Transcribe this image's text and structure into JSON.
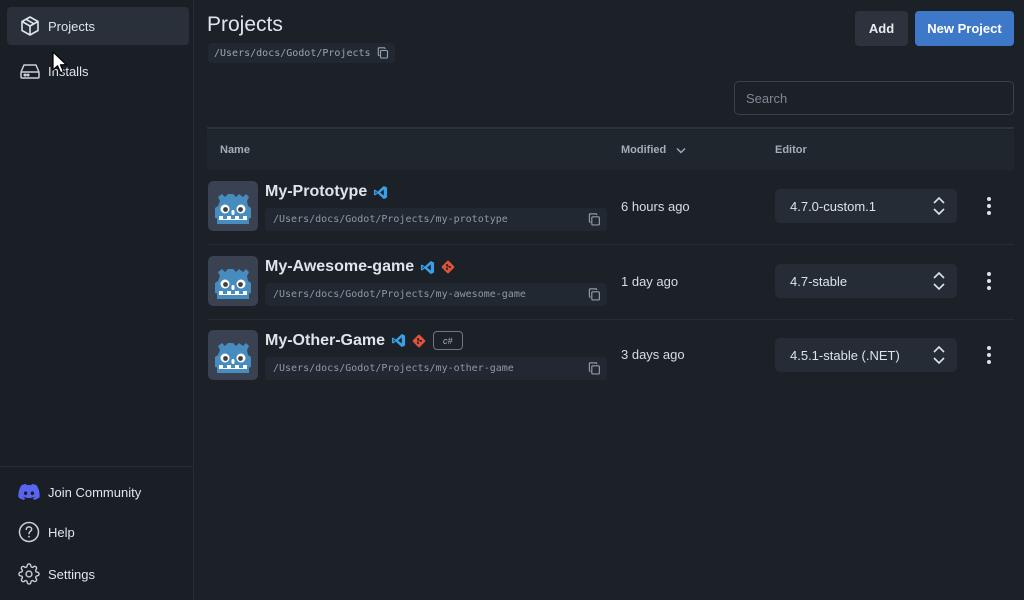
{
  "sidebar": {
    "items": [
      {
        "label": "Projects",
        "icon": "package-icon",
        "active": true
      },
      {
        "label": "Installs",
        "icon": "drive-icon",
        "active": false
      }
    ],
    "bottom": [
      {
        "label": "Join Community",
        "icon": "discord-icon"
      },
      {
        "label": "Help",
        "icon": "help-icon"
      },
      {
        "label": "Settings",
        "icon": "gear-icon"
      }
    ]
  },
  "header": {
    "title": "Projects",
    "path": "/Users/docs/Godot/Projects",
    "add_label": "Add",
    "new_project_label": "New Project",
    "search_placeholder": "Search"
  },
  "table": {
    "columns": {
      "name": "Name",
      "modified": "Modified",
      "editor": "Editor"
    },
    "rows": [
      {
        "name": "My-Prototype",
        "path": "/Users/docs/Godot/Projects/my-prototype",
        "modified": "6 hours ago",
        "editor": "4.7.0-custom.1",
        "tags": [
          "vscode-icon"
        ],
        "csharp": ""
      },
      {
        "name": "My-Awesome-game",
        "path": "/Users/docs/Godot/Projects/my-awesome-game",
        "modified": "1 day ago",
        "editor": "4.7-stable",
        "tags": [
          "vscode-icon",
          "git-icon"
        ],
        "csharp": ""
      },
      {
        "name": "My-Other-Game",
        "path": "/Users/docs/Godot/Projects/my-other-game",
        "modified": "3 days ago",
        "editor": "4.5.1-stable (.NET)",
        "tags": [
          "vscode-icon",
          "git-icon"
        ],
        "csharp": "c#"
      }
    ]
  },
  "colors": {
    "accent": "#3e78c9",
    "background": "#1c2128",
    "vscode": "#3aa0e8",
    "git": "#e0533a",
    "godot": "#478cbf"
  }
}
